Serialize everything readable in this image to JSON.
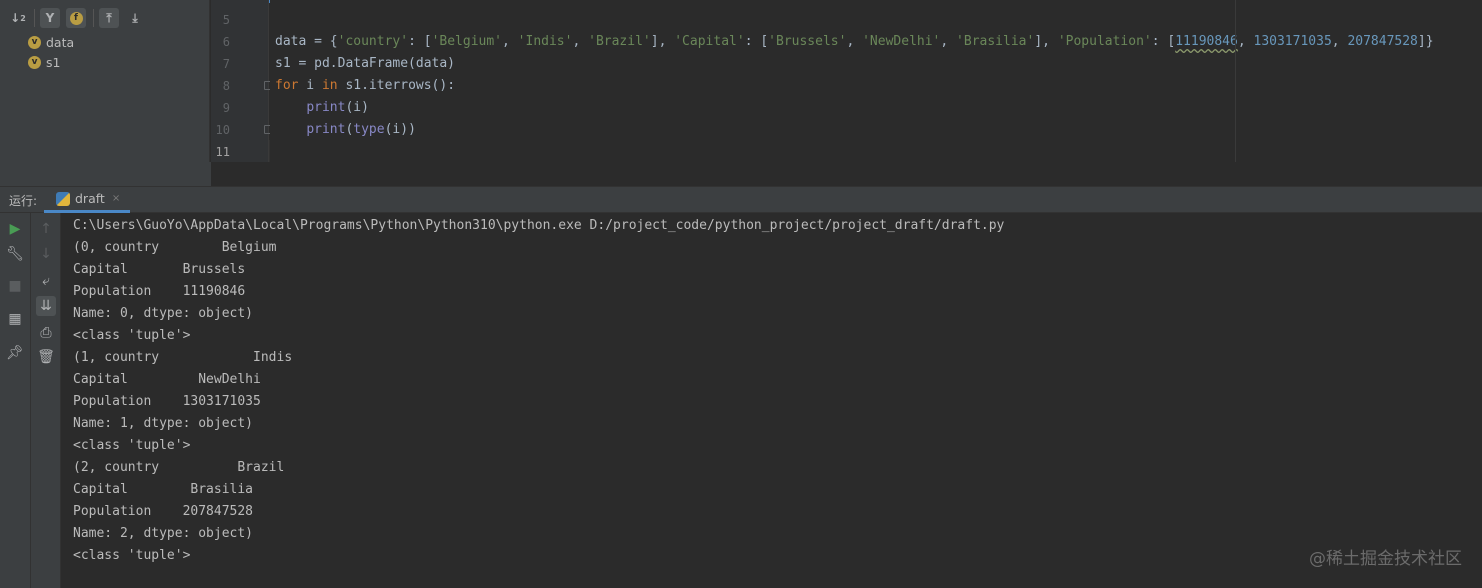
{
  "structure_panel": {
    "toolbar_icons": [
      "sort-icon",
      "filter-icon",
      "field-icon",
      "expand-icon",
      "collapse-icon"
    ],
    "variables": [
      {
        "badge": "v",
        "name": "data"
      },
      {
        "badge": "v",
        "name": "s1"
      }
    ]
  },
  "editor": {
    "line_numbers": [
      "5",
      "6",
      "7",
      "8",
      "9",
      "10",
      "11"
    ],
    "current_line": "11",
    "code": {
      "l6": {
        "a": "data = {",
        "k1": "'country'",
        "c1": ": [",
        "v1": "'Belgium'",
        "c2": ", ",
        "v2": "'Indis'",
        "c3": ", ",
        "v3": "'Brazil'",
        "c4": "], ",
        "k2": "'Capital'",
        "c5": ": [",
        "v4": "'Brussels'",
        "c6": ", ",
        "v5": "'NewDelhi'",
        "c7": ", ",
        "v6": "'Brasilia'",
        "c8": "], ",
        "k3": "'Population'",
        "c9": ": [",
        "n1": "11190846",
        "c10": ", ",
        "n2": "1303171035",
        "c11": ", ",
        "n3": "207847528",
        "c12": "]}"
      },
      "l7": "s1 = pd.DataFrame(data)",
      "l8": {
        "kw1": "for",
        "a": " i ",
        "kw2": "in",
        "b": " s1.iterrows():"
      },
      "l9": {
        "indent": "    ",
        "fn": "print",
        "rest": "(i)"
      },
      "l10": {
        "indent": "    ",
        "fn1": "print",
        "p1": "(",
        "fn2": "type",
        "rest": "(i))"
      }
    }
  },
  "run_panel": {
    "label": "运行:",
    "tab_label": "draft",
    "close_glyph": "×"
  },
  "console": {
    "lines": [
      "C:\\Users\\GuoYo\\AppData\\Local\\Programs\\Python\\Python310\\python.exe D:/project_code/python_project/project_draft/draft.py",
      "(0, country        Belgium",
      "Capital       Brussels",
      "Population    11190846",
      "Name: 0, dtype: object)",
      "<class 'tuple'>",
      "(1, country            Indis",
      "Capital         NewDelhi",
      "Population    1303171035",
      "Name: 1, dtype: object)",
      "<class 'tuple'>",
      "(2, country          Brazil",
      "Capital        Brasilia",
      "Population    207847528",
      "Name: 2, dtype: object)",
      "<class 'tuple'>"
    ]
  },
  "watermark": "@稀土掘金技术社区",
  "colors": {
    "background": "#2b2b2b",
    "panel": "#3c3f41",
    "keyword": "#cc7832",
    "string": "#6a8759",
    "number": "#6897bb",
    "builtin": "#8888c6",
    "accent": "#4a88c7",
    "run_green": "#499c54"
  }
}
